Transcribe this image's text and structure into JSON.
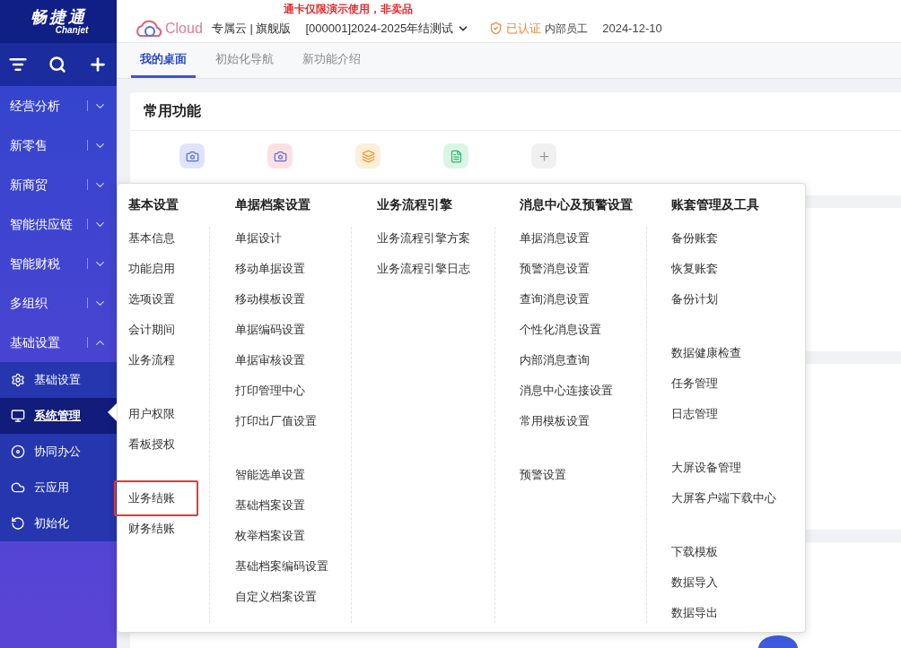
{
  "sidebar": {
    "logo": {
      "title": "畅捷通",
      "subtitle": "Chanjet"
    },
    "nav": [
      {
        "label": "经营分析",
        "expanded": false
      },
      {
        "label": "新零售",
        "expanded": false
      },
      {
        "label": "新商贸",
        "expanded": false
      },
      {
        "label": "智能供应链",
        "expanded": false
      },
      {
        "label": "智能财税",
        "expanded": false
      },
      {
        "label": "多组织",
        "expanded": false
      },
      {
        "label": "基础设置",
        "expanded": true,
        "children": [
          {
            "label": "基础设置",
            "kind": "settings",
            "selected": false
          },
          {
            "label": "系统管理",
            "kind": "monitor",
            "selected": true
          },
          {
            "label": "协同办公",
            "kind": "sync",
            "selected": false
          },
          {
            "label": "云应用",
            "kind": "cloud",
            "selected": false
          },
          {
            "label": "初始化",
            "kind": "refresh",
            "selected": false
          }
        ]
      }
    ]
  },
  "header": {
    "brand": "Cloud",
    "edition": "专属云 | 旗舰版",
    "notice": "通卡仅限演示使用，非卖品",
    "account": "[000001]2024-2025年结测试",
    "certified": "已认证",
    "role": "内部员工",
    "date": "2024-12-10"
  },
  "tabs": [
    {
      "label": "我的桌面",
      "selected": true
    },
    {
      "label": "初始化导航",
      "selected": false
    },
    {
      "label": "新功能介绍",
      "selected": false
    }
  ],
  "card": {
    "title": "常用功能",
    "shortcuts": [
      {
        "color": "#dfe3fb",
        "kind": "camera"
      },
      {
        "color": "#fde0e3",
        "kind": "camera"
      },
      {
        "color": "#fdefd9",
        "kind": "stack"
      },
      {
        "color": "#daf5e6",
        "kind": "doc"
      },
      {
        "color": "#f0f0f0",
        "kind": "plus"
      }
    ]
  },
  "menu": {
    "columns": [
      {
        "title": "基本设置",
        "groups": [
          [
            {
              "label": "基本信息",
              "highlighted": false
            },
            {
              "label": "功能启用",
              "highlighted": false
            },
            {
              "label": "选项设置",
              "highlighted": false
            },
            {
              "label": "会计期间",
              "highlighted": false
            },
            {
              "label": "业务流程",
              "highlighted": false
            }
          ],
          [
            {
              "label": "用户权限",
              "highlighted": false
            },
            {
              "label": "看板授权",
              "highlighted": false
            }
          ],
          [
            {
              "label": "业务结账",
              "highlighted": true
            },
            {
              "label": "财务结账",
              "highlighted": false
            }
          ]
        ]
      },
      {
        "title": "单据档案设置",
        "groups": [
          [
            {
              "label": "单据设计",
              "highlighted": false
            },
            {
              "label": "移动单据设置",
              "highlighted": false
            },
            {
              "label": "移动模板设置",
              "highlighted": false
            },
            {
              "label": "单据编码设置",
              "highlighted": false
            },
            {
              "label": "单据审核设置",
              "highlighted": false
            },
            {
              "label": "打印管理中心",
              "highlighted": false
            },
            {
              "label": "打印出厂值设置",
              "highlighted": false
            }
          ],
          [
            {
              "label": "智能选单设置",
              "highlighted": false
            },
            {
              "label": "基础档案设置",
              "highlighted": false
            },
            {
              "label": "枚举档案设置",
              "highlighted": false
            },
            {
              "label": "基础档案编码设置",
              "highlighted": false
            },
            {
              "label": "自定义档案设置",
              "highlighted": false
            }
          ]
        ]
      },
      {
        "title": "业务流程引擎",
        "groups": [
          [
            {
              "label": "业务流程引擎方案",
              "highlighted": false
            },
            {
              "label": "业务流程引擎日志",
              "highlighted": false
            }
          ]
        ]
      },
      {
        "title": "消息中心及预警设置",
        "groups": [
          [
            {
              "label": "单据消息设置",
              "highlighted": false
            },
            {
              "label": "预警消息设置",
              "highlighted": false
            },
            {
              "label": "查询消息设置",
              "highlighted": false
            },
            {
              "label": "个性化消息设置",
              "highlighted": false
            },
            {
              "label": "内部消息查询",
              "highlighted": false
            },
            {
              "label": "消息中心连接设置",
              "highlighted": false
            },
            {
              "label": "常用模板设置",
              "highlighted": false
            }
          ],
          [
            {
              "label": "预警设置",
              "highlighted": false
            }
          ]
        ]
      },
      {
        "title": "账套管理及工具",
        "groups": [
          [
            {
              "label": "备份账套",
              "highlighted": false
            },
            {
              "label": "恢复账套",
              "highlighted": false
            },
            {
              "label": "备份计划",
              "highlighted": false
            }
          ],
          [
            {
              "label": "数据健康检查",
              "highlighted": false
            },
            {
              "label": "任务管理",
              "highlighted": false
            },
            {
              "label": "日志管理",
              "highlighted": false
            }
          ],
          [
            {
              "label": "大屏设备管理",
              "highlighted": false
            },
            {
              "label": "大屏客户端下载中心",
              "highlighted": false
            }
          ],
          [
            {
              "label": "下载模板",
              "highlighted": false
            },
            {
              "label": "数据导入",
              "highlighted": false
            },
            {
              "label": "数据导出",
              "highlighted": false
            }
          ]
        ]
      }
    ]
  }
}
